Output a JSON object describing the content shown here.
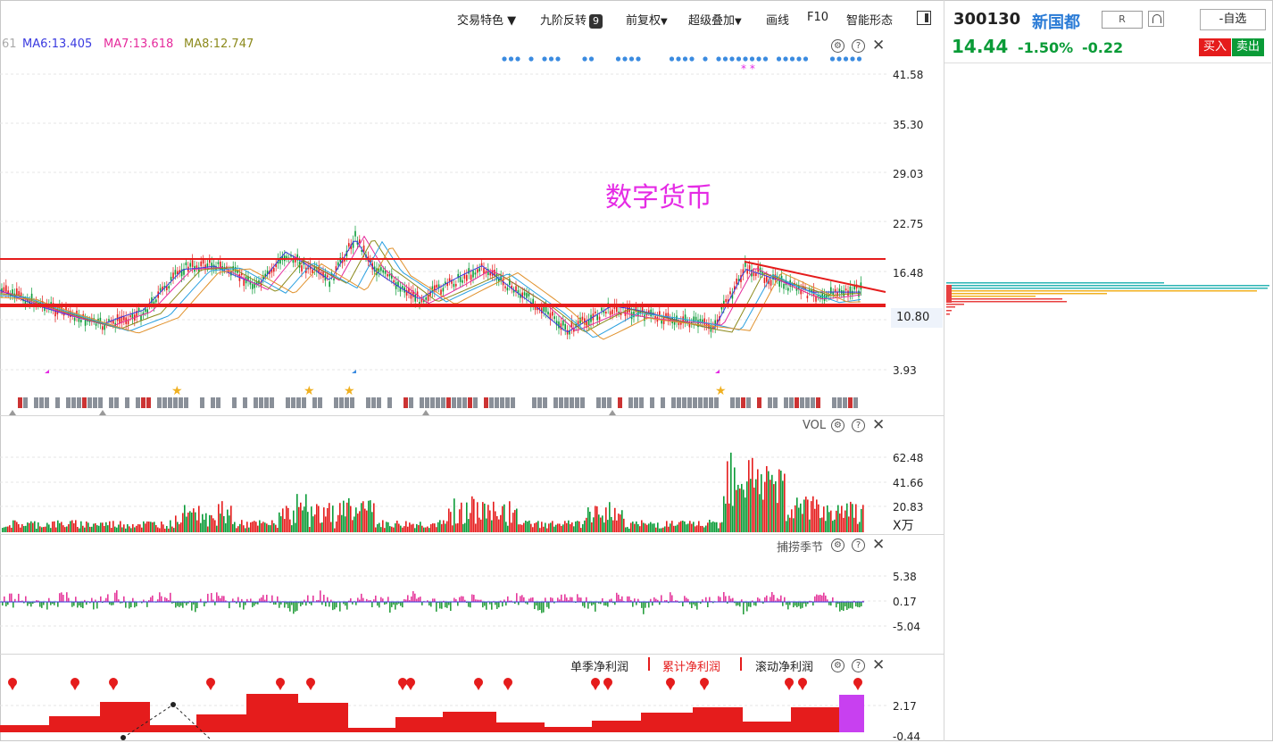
{
  "toolbar": {
    "trade_features": "交易特色",
    "nine_reversal": "九阶反转",
    "nine_badge": "9",
    "adjust": "前复权",
    "overlay": "超级叠加",
    "draw": "画线",
    "f10": "F10",
    "smart_pattern": "智能形态"
  },
  "ma": {
    "partial": "61",
    "ma6": "MA6:13.405",
    "ma7": "MA7:13.618",
    "ma8": "MA8:12.747"
  },
  "ma_colors": {
    "ma6": "#3a3ae0",
    "ma7": "#e52b9c",
    "ma8": "#8c8a1c"
  },
  "main_chart": {
    "watermark": "数字货币",
    "y_labels": [
      "41.58",
      "35.30",
      "29.03",
      "22.75",
      "16.48",
      "10.80",
      "3.93"
    ]
  },
  "vol_panel": {
    "title": "VOL",
    "y_labels": [
      "62.48",
      "41.66",
      "20.83"
    ],
    "unit": "X万"
  },
  "season_panel": {
    "title": "捕捞季节",
    "y_labels": [
      "5.38",
      "0.17",
      "-5.04"
    ]
  },
  "profit_panel": {
    "tab_single": "单季净利润",
    "tab_cumulative": "累计净利润",
    "tab_rolling": "滚动净利润",
    "y_labels": [
      "2.17",
      "-0.44"
    ]
  },
  "quote": {
    "code": "300130",
    "name": "新国都",
    "r_label": "R",
    "watchlist": "-自选",
    "price": "14.44",
    "change_pct": "-1.50%",
    "change": "-0.22",
    "buy": "买入",
    "sell": "卖出"
  },
  "colors": {
    "up": "#e51c1c",
    "down": "#0a9b37",
    "accent": "#2a7bd6",
    "magenta": "#e52be5"
  }
}
